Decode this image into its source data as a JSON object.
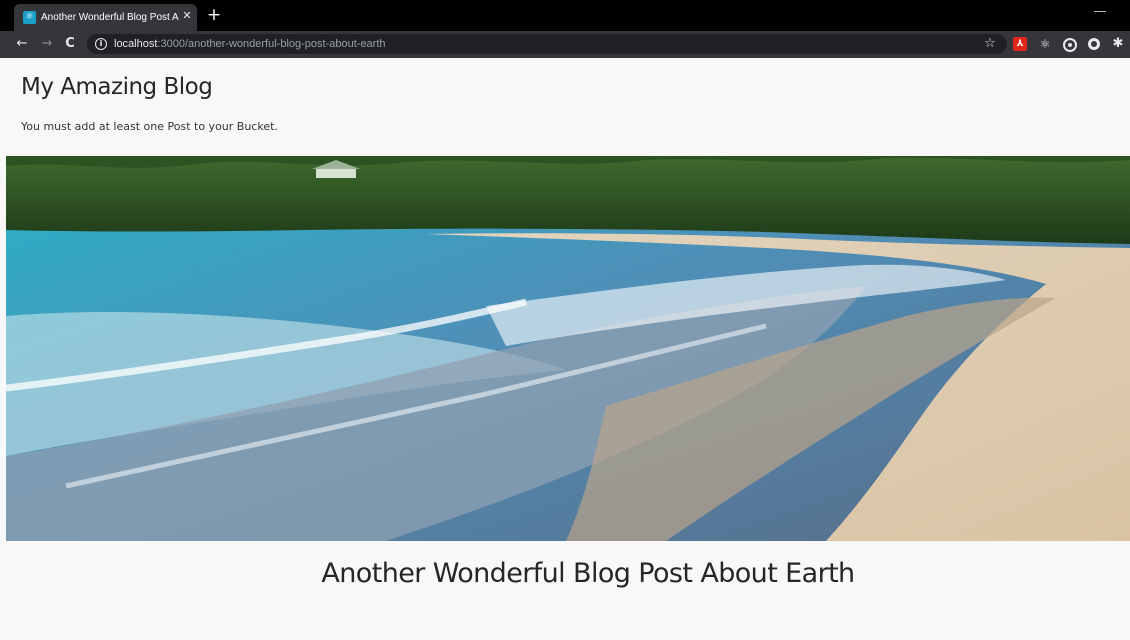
{
  "browser": {
    "tab_title": "Another Wonderful Blog Post Ab",
    "new_tab_symbol": "+",
    "url_host": "localhost",
    "url_path": ":3000/another-wonderful-blog-post-about-earth",
    "icons": [
      "favicon",
      "back-icon",
      "forward-icon",
      "reload-icon",
      "info-icon",
      "star-icon",
      "pdf-extension-icon",
      "react-devtools-icon",
      "circle-extension-icon",
      "dot-extension-icon",
      "puzzle-extension-icon",
      "minimize-icon"
    ]
  },
  "page": {
    "site_title": "My Amazing Blog",
    "notice": "You must add at least one Post to your Bucket.",
    "post_title": "Another Wonderful Blog Post About Earth",
    "hero_image": "beach-photo"
  },
  "colors": {
    "chrome_dark": "#35363a",
    "tab_strip": "#000000",
    "omnibox": "#202124",
    "page_background": "#f8f8f8",
    "text": "#262626"
  }
}
